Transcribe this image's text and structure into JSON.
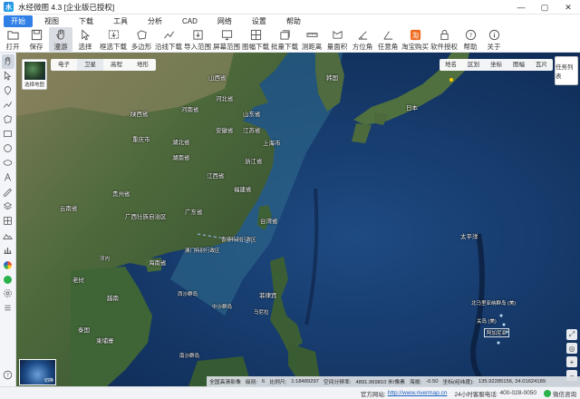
{
  "window": {
    "title": "水经微图 4.3 [企业版已授权]",
    "controls": [
      "—",
      "▢",
      "✕"
    ]
  },
  "menu": [
    {
      "label": "开始",
      "active": true
    },
    {
      "label": "视图"
    },
    {
      "label": "下载"
    },
    {
      "label": "工具"
    },
    {
      "label": "分析"
    },
    {
      "label": "CAD"
    },
    {
      "label": "网络"
    },
    {
      "label": "设置"
    },
    {
      "label": "帮助"
    }
  ],
  "toolbar": [
    {
      "label": "打开",
      "icon": "folder-icon"
    },
    {
      "label": "保存",
      "icon": "save-icon"
    },
    {
      "label": "漫游",
      "icon": "hand-icon",
      "active": true
    },
    {
      "label": "选择",
      "icon": "cursor-icon"
    },
    {
      "label": "框选下载",
      "icon": "box-download-icon"
    },
    {
      "label": "多边形",
      "icon": "polygon-icon"
    },
    {
      "label": "沿线下载",
      "icon": "line-download-icon"
    },
    {
      "label": "导入范围",
      "icon": "import-icon"
    },
    {
      "label": "屏幕范围",
      "icon": "screen-icon"
    },
    {
      "label": "图幅下载",
      "icon": "sheet-icon"
    },
    {
      "label": "批量下载",
      "icon": "batch-icon"
    },
    {
      "label": "测距离",
      "icon": "ruler-icon"
    },
    {
      "label": "量面积",
      "icon": "area-icon"
    },
    {
      "label": "方位角",
      "icon": "azimuth-icon"
    },
    {
      "label": "任意角",
      "icon": "angle-icon"
    },
    {
      "label": "淘宝购买",
      "icon": "taobao-icon"
    },
    {
      "label": "软件授权",
      "icon": "lock-icon"
    },
    {
      "label": "帮助",
      "icon": "help-icon"
    },
    {
      "label": "关于",
      "icon": "info-icon"
    }
  ],
  "map": {
    "thumbnail_label": "选择地图",
    "tabs": [
      {
        "label": "电子"
      },
      {
        "label": "卫星",
        "active": true
      },
      {
        "label": "高程"
      },
      {
        "label": "地形"
      }
    ],
    "layer_buttons": [
      "地名",
      "区划",
      "坐标",
      "图幅",
      "瓦片"
    ],
    "task_list_label": "任务列表",
    "minimap_label": "切换",
    "places": [
      {
        "name": "山西省"
      },
      {
        "name": "河北省"
      },
      {
        "name": "山东省"
      },
      {
        "name": "河南省"
      },
      {
        "name": "陕西省"
      },
      {
        "name": "安徽省"
      },
      {
        "name": "江苏省"
      },
      {
        "name": "湖北省"
      },
      {
        "name": "上海市"
      },
      {
        "name": "重庆市"
      },
      {
        "name": "浙江省"
      },
      {
        "name": "湖南省"
      },
      {
        "name": "江西省"
      },
      {
        "name": "贵州省"
      },
      {
        "name": "福建省"
      },
      {
        "name": "云南省"
      },
      {
        "name": "广西壮族自治区"
      },
      {
        "name": "广东省"
      },
      {
        "name": "台湾省"
      },
      {
        "name": "香港特别行政区"
      },
      {
        "name": "澳门特别行政区"
      },
      {
        "name": "海南省"
      },
      {
        "name": "韩国"
      },
      {
        "name": "日本"
      },
      {
        "name": "老挝"
      },
      {
        "name": "越南"
      },
      {
        "name": "泰国"
      },
      {
        "name": "柬埔寨"
      },
      {
        "name": "菲律宾"
      },
      {
        "name": "太平洋"
      },
      {
        "name": "北马里亚纳群岛 (美)"
      },
      {
        "name": "关岛 (美)"
      },
      {
        "name": "阿加尼亚"
      },
      {
        "name": "西沙群岛"
      },
      {
        "name": "中沙群岛"
      },
      {
        "name": "南沙群岛"
      },
      {
        "name": "河内"
      },
      {
        "name": "马尼拉"
      }
    ],
    "coordinates": {
      "sheet_label": "全国高清影像",
      "level_label": "级别:",
      "level": "6",
      "scale_label": "比例尺:",
      "scale": "1:18489297",
      "resolution_label": "空间分辨率:",
      "resolution": "4891.969810 米/像素",
      "elevation_label": "海拔:",
      "elevation": "-0.50",
      "coord_label": "坐标(经纬度):",
      "coord": "135.92285156, 34.01624189"
    }
  },
  "status": {
    "site_label": "官方网站:",
    "site": "http://www.rivermap.cn",
    "hotline_label": "24小时客服电话:",
    "hotline": "400-028-0050",
    "wechat": "微信咨询"
  }
}
